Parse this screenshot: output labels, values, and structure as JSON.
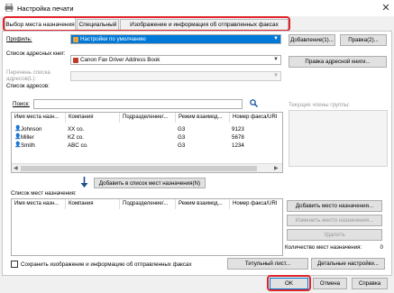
{
  "window": {
    "title": "Настройка печати"
  },
  "tabs": [
    {
      "label": "Выбор места назначения"
    },
    {
      "label": "Специальный"
    },
    {
      "label": "Изображение и информация об отправленных факсах"
    }
  ],
  "profile": {
    "label": "Профиль:",
    "value": "Настройки по умолчанию",
    "add_label": "Добавление(1)...",
    "edit_label": "Правка(2)..."
  },
  "address_book": {
    "label": "Список адресных книг:",
    "value": "Canon Fax Driver Address Book",
    "edit_label": "Правка адресной книги..."
  },
  "address_list_list": {
    "label": "Перечень списка адресов(L):"
  },
  "address_list": {
    "label": "Список адресов:"
  },
  "search": {
    "label": "Поиск:",
    "value": ""
  },
  "group_members": {
    "label": "Текущие члены группы:"
  },
  "address_table": {
    "columns": [
      "Имя места назн...",
      "Компания",
      "Подразделение/...",
      "Режим взаимод...",
      "Номер факса/URI"
    ],
    "rows": [
      {
        "name": "Johnson",
        "company": "XX co.",
        "dept": "",
        "mode": "G3",
        "number": "9123"
      },
      {
        "name": "Miller",
        "company": "KZ co.",
        "dept": "",
        "mode": "G3",
        "number": "5678"
      },
      {
        "name": "Smith",
        "company": "ABC co.",
        "dept": "",
        "mode": "G3",
        "number": "1234"
      }
    ]
  },
  "add_to_dest": {
    "label": "Добавить в список мест назначения(N)"
  },
  "dest_list": {
    "label": "Список мест назначения:",
    "columns": [
      "Имя места назн...",
      "Компания",
      "Подразделение/...",
      "Режим взаимод...",
      "Номер факса/URI"
    ]
  },
  "dest_actions": {
    "add_label": "Добавить место назначения...",
    "edit_label": "Изменить место назначения...",
    "delete_label": "Удалить",
    "count_label": "Количество мест назначения:",
    "count_value": "0"
  },
  "save_image": {
    "label": "Сохранить изображение и информацию об отправленных факсах",
    "checked": false
  },
  "footer": {
    "cover_label": "Титульный лист...",
    "detail_label": "Детальные настройки...",
    "ok_label": "OK",
    "cancel_label": "Отмена",
    "help_label": "Справка"
  },
  "icons": {
    "app": "printer-icon",
    "close": "close-icon",
    "search": "search-icon",
    "person": "person-icon",
    "address_book": "address-book-icon",
    "profile": "profile-icon",
    "arrow": "arrow-down-icon"
  },
  "colors": {
    "accent": "#0078d7",
    "highlight": "#e0242b"
  }
}
